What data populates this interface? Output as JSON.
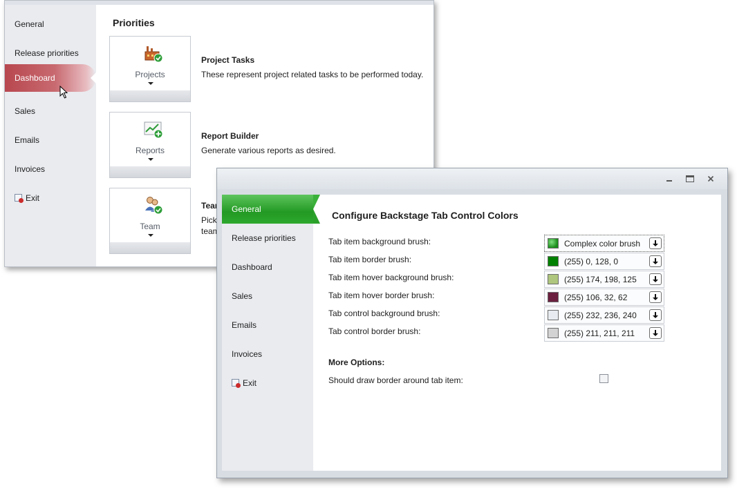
{
  "back_window": {
    "nav": [
      "General",
      "Release priorities",
      "Dashboard",
      "Sales",
      "Emails",
      "Invoices"
    ],
    "selected_nav": "Dashboard",
    "exit_label": "Exit",
    "section_title": "Priorities",
    "items": [
      {
        "tile_label": "Projects",
        "title": "Project Tasks",
        "description": "These represent project related tasks to be performed today.",
        "icon": "projects-icon"
      },
      {
        "tile_label": "Reports",
        "title": "Report Builder",
        "description": "Generate various reports as desired.",
        "icon": "reports-icon"
      },
      {
        "tile_label": "Team",
        "title": "Tear",
        "description_line1": "Pick",
        "description_line2": "team",
        "icon": "team-icon"
      }
    ]
  },
  "front_window": {
    "nav": [
      "General",
      "Release priorities",
      "Dashboard",
      "Sales",
      "Emails",
      "Invoices"
    ],
    "selected_nav": "General",
    "exit_label": "Exit",
    "title": "Configure Backstage Tab Control Colors",
    "brushes": [
      {
        "label": "Tab item background brush:",
        "value": "Complex color brush",
        "color": "#1f9d1f"
      },
      {
        "label": "Tab item border brush:",
        "value": "(255)  0, 128, 0",
        "color": "#008000"
      },
      {
        "label": "Tab item hover background brush:",
        "value": "(255)  174, 198, 125",
        "color": "#aec67d"
      },
      {
        "label": "Tab item hover border brush:",
        "value": "(255)  106, 32, 62",
        "color": "#6a203e"
      },
      {
        "label": "Tab control background brush:",
        "value": "(255)  232, 236, 240",
        "color": "#e8ecf0"
      },
      {
        "label": "Tab control border brush:",
        "value": "(255)  211, 211, 211",
        "color": "#d3d3d3"
      }
    ],
    "more_options_label": "More Options:",
    "border_checkbox_label": "Should draw border around tab item:",
    "border_checkbox_checked": false
  }
}
